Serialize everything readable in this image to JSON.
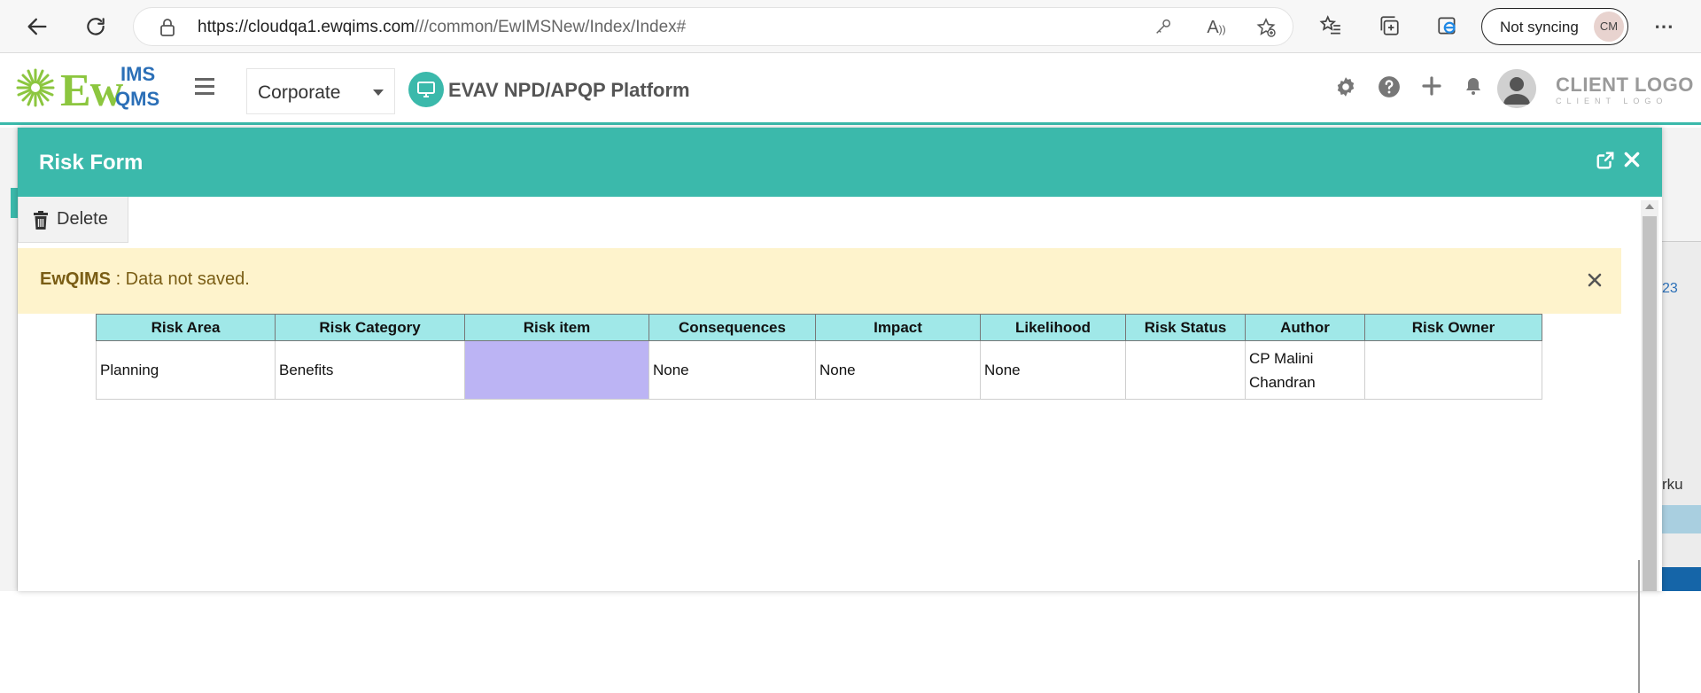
{
  "browser": {
    "url_host": "https://cloudqa1.ewqims.com",
    "url_path": "///common/EwIMSNew/Index/Index#",
    "sync_label": "Not syncing",
    "profile_initials": "CM"
  },
  "header": {
    "logo_ew": "Ew",
    "logo_ims": "IMS",
    "logo_qms": "QMS",
    "org_select": "Corporate",
    "platform_title": "EVAV NPD/APQP Platform",
    "client_logo": "CLIENT LOGO",
    "client_logo_sub": "CLIENT LOGO"
  },
  "background_page": {
    "partial_number": "23",
    "partial_text": "rku"
  },
  "modal": {
    "title": "Risk Form",
    "delete_label": "Delete",
    "alert_brand": "EwQIMS",
    "alert_message": " : Data not saved."
  },
  "table": {
    "headers": [
      "Risk Area",
      "Risk Category",
      "Risk item",
      "Consequences",
      "Impact",
      "Likelihood",
      "Risk Status",
      "Author",
      "Risk Owner"
    ],
    "rows": [
      {
        "risk_area": "Planning",
        "risk_category": "Benefits",
        "risk_item": "",
        "consequences": "None",
        "impact": "None",
        "likelihood": "None",
        "risk_status": "",
        "author_line1": "CP Malini",
        "author_line2": "Chandran",
        "risk_owner": ""
      }
    ]
  },
  "colors": {
    "accent": "#3bb9ab",
    "alert_bg": "#fef3cc",
    "table_header_bg": "#a0e8e8",
    "risk_item_bg": "#bcb4f4"
  }
}
